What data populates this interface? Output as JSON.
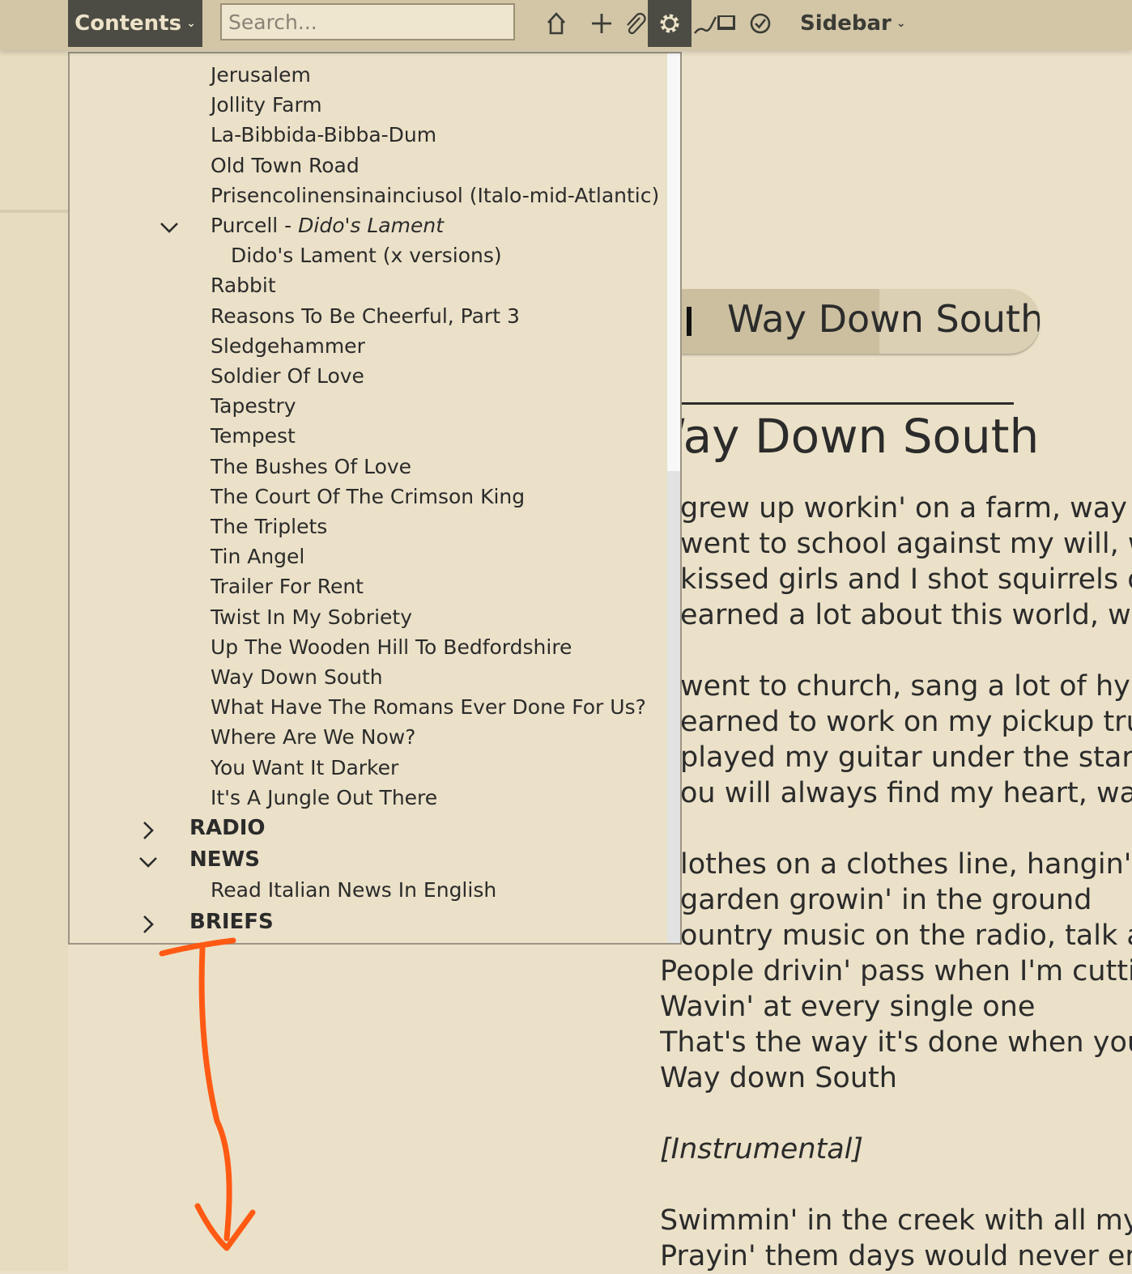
{
  "toolbar": {
    "contents_label": "Contents",
    "search_placeholder": "Search...",
    "sidebar_label": "Sidebar",
    "icons": [
      "home-icon",
      "plus-icon",
      "paperclip-icon",
      "gear-icon",
      "edit-icon",
      "checkmark-circle-icon"
    ]
  },
  "toc": {
    "items": [
      {
        "label": "Jerusalem"
      },
      {
        "label": "Jollity Farm"
      },
      {
        "label": "La-Bibbida-Bibba-Dum"
      },
      {
        "label": "Old Town Road"
      },
      {
        "label": "Prisencolinensinainciusol (Italo-mid-Atlantic)"
      },
      {
        "label": "Purcell - ",
        "italic": "Dido's Lament",
        "expanded": true
      },
      {
        "label": "Dido's Lament (x versions)"
      },
      {
        "label": "Rabbit"
      },
      {
        "label": "Reasons To Be Cheerful, Part 3"
      },
      {
        "label": "Sledgehammer"
      },
      {
        "label": "Soldier Of Love"
      },
      {
        "label": "Tapestry"
      },
      {
        "label": "Tempest"
      },
      {
        "label": "The Bushes Of Love"
      },
      {
        "label": "The Court Of The Crimson King"
      },
      {
        "label": "The Triplets"
      },
      {
        "label": "Tin Angel"
      },
      {
        "label": "Trailer For Rent"
      },
      {
        "label": "Twist In My Sobriety"
      },
      {
        "label": "Up The Wooden Hill To Bedfordshire"
      },
      {
        "label": "Way Down South"
      },
      {
        "label": "What Have The Romans Ever Done For Us?"
      },
      {
        "label": "Where Are We Now?"
      },
      {
        "label": "You Want It Darker"
      },
      {
        "label": "It's A Jungle Out There"
      }
    ],
    "sections": [
      {
        "label": "RADIO",
        "expanded": false
      },
      {
        "label": "NEWS",
        "expanded": true,
        "children": [
          "Read Italian News In English"
        ]
      },
      {
        "label": "BRIEFS",
        "expanded": false
      }
    ]
  },
  "player": {
    "title": "Way Down South",
    "progress": 0.6
  },
  "song": {
    "title": "Way Down South",
    "lyrics": [
      "grew up workin' on a farm, way d",
      "went to school against my will, wa",
      "kissed girls and I shot squirrels ou",
      "earned a lot about this world, wa",
      "",
      "went to church, sang a lot of hym",
      "earned to work on my pickup tru",
      "played my guitar under the stars,",
      "ou will always find my heart, way",
      "",
      "lothes on a clothes line, hangin' i",
      " garden growin' in the ground",
      "ountry music on the radio, talk ab",
      "People drivin' pass when I'm cuttin",
      "Wavin' at every single one",
      "That's the way it's done when you",
      "Way down South",
      "",
      "[Instrumental]",
      "",
      "Swimmin' in the creek with all my f",
      "Prayin' them days would never end"
    ]
  },
  "colors": {
    "toolbar": "#d2c6a7",
    "page": "#ebe1c8",
    "annotation": "#ff5a14"
  }
}
